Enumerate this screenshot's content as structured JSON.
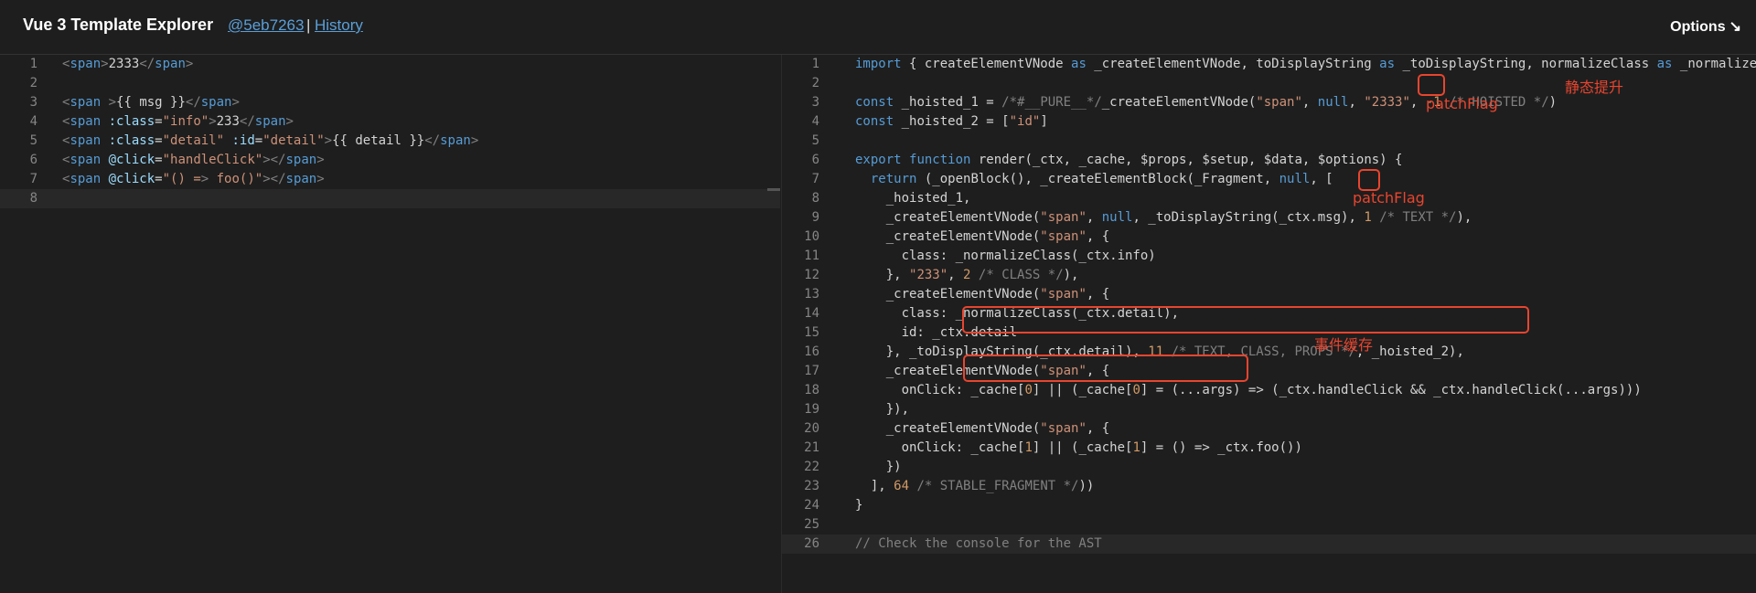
{
  "header": {
    "title": "Vue 3 Template Explorer",
    "commit": "@5eb7263",
    "separator": "|",
    "history": "History",
    "options": "Options",
    "options_arrow": "↘"
  },
  "editor_left": {
    "lines": [
      "<span>2333</span>",
      "",
      "<span >{{ msg }}</span>",
      "<span :class=\"info\">233</span>",
      "<span :class=\"detail\" :id=\"detail\">{{ detail }}</span>",
      "<span @click=\"handleClick\"></span>",
      "<span @click=\"() => foo()\"></span>",
      ""
    ]
  },
  "editor_right": {
    "lines": [
      "import { createElementVNode as _createElementVNode, toDisplayString as _toDisplayString, normalizeClass as _normalize",
      "",
      "const _hoisted_1 = /*#__PURE__*/_createElementVNode(\"span\", null, \"2333\", -1 /* HOISTED */)",
      "const _hoisted_2 = [\"id\"]",
      "",
      "export function render(_ctx, _cache, $props, $setup, $data, $options) {",
      "  return (_openBlock(), _createElementBlock(_Fragment, null, [",
      "    _hoisted_1,",
      "    _createElementVNode(\"span\", null, _toDisplayString(_ctx.msg), 1 /* TEXT */),",
      "    _createElementVNode(\"span\", {",
      "      class: _normalizeClass(_ctx.info)",
      "    }, \"233\", 2 /* CLASS */),",
      "    _createElementVNode(\"span\", {",
      "      class: _normalizeClass(_ctx.detail),",
      "      id: _ctx.detail",
      "    }, _toDisplayString(_ctx.detail), 11 /* TEXT, CLASS, PROPS */, _hoisted_2),",
      "    _createElementVNode(\"span\", {",
      "      onClick: _cache[0] || (_cache[0] = (...args) => (_ctx.handleClick && _ctx.handleClick(...args)))",
      "    }),",
      "    _createElementVNode(\"span\", {",
      "      onClick: _cache[1] || (_cache[1] = () => _ctx.foo())",
      "    })",
      "  ], 64 /* STABLE_FRAGMENT */))",
      "}",
      "",
      "// Check the console for the AST"
    ]
  },
  "annotations": {
    "hoist_label": "静态提升",
    "patch_flag_label_1": "patchFlag",
    "patch_flag_label_2": "patchFlag",
    "event_cache_label": "事件缓存"
  }
}
